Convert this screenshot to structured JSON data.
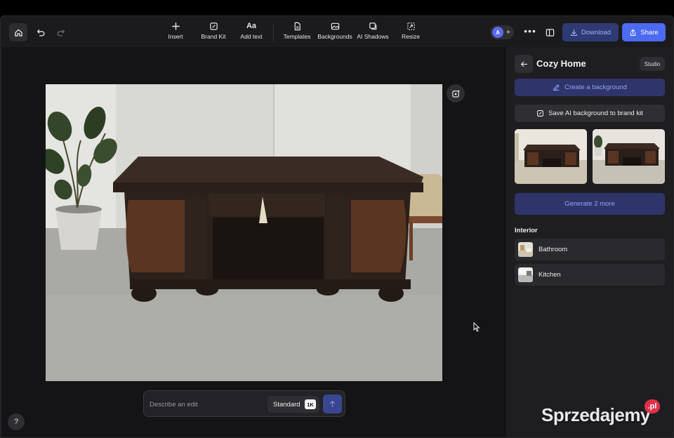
{
  "toolbar": {
    "tools": [
      {
        "label": "Insert",
        "icon": "plus-icon"
      },
      {
        "label": "Brand Kit",
        "icon": "brand-kit-icon"
      },
      {
        "label": "Add text",
        "icon": "text-icon"
      },
      {
        "label": "Templates",
        "icon": "templates-icon"
      },
      {
        "label": "Backgrounds",
        "icon": "backgrounds-icon"
      },
      {
        "label": "AI Shadows",
        "icon": "shadows-icon"
      },
      {
        "label": "Resize",
        "icon": "resize-icon"
      }
    ],
    "avatar_initial": "A",
    "download_label": "Download",
    "share_label": "Share"
  },
  "prompt": {
    "placeholder": "Describe an edit",
    "quality": "Standard",
    "resolution": "1K"
  },
  "panel": {
    "title": "Cozy Home",
    "badge": "Studio",
    "create_label": "Create a background",
    "save_label": "Save AI background to brand kit",
    "generate_label": "Generate 2 more",
    "section_title": "Interior",
    "items": [
      {
        "label": "Bathroom"
      },
      {
        "label": "Kitchen"
      }
    ]
  },
  "help_label": "?",
  "watermark": {
    "text": "Sprzedajemy",
    "badge": ".pl"
  },
  "colors": {
    "accent": "#4d6af2",
    "accent_soft": "#2f3569",
    "background": "#1b1b1d"
  }
}
